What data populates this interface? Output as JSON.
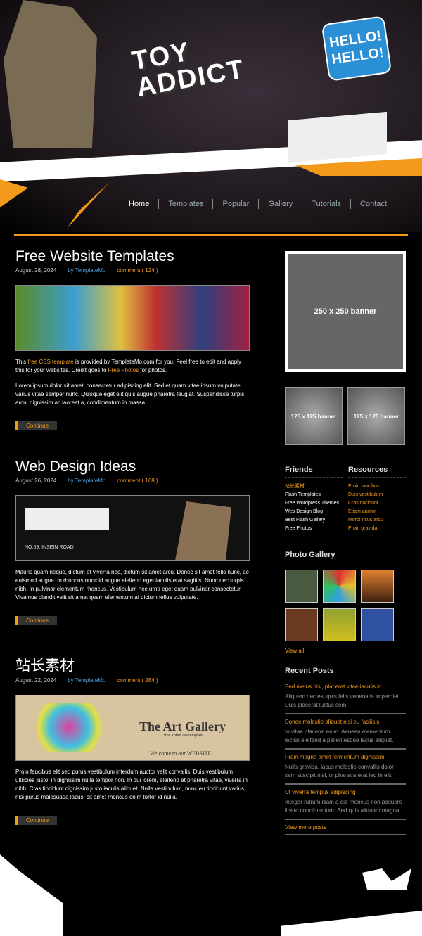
{
  "header": {
    "logo_text": "TOY ADDICT",
    "bubble_text": "HELLO! HELLO!"
  },
  "nav": [
    {
      "label": "Home"
    },
    {
      "label": "Templates"
    },
    {
      "label": "Popular"
    },
    {
      "label": "Gallery"
    },
    {
      "label": "Tutorials"
    },
    {
      "label": "Contact"
    }
  ],
  "posts": [
    {
      "title": "Free Website Templates",
      "date": "August 28, 2024",
      "author": "by TemplateMo",
      "comments": "comment ( 124 )",
      "intro_pre": "This ",
      "intro_link1": "free CSS template",
      "intro_mid": " is provided by TemplateMo.com for you. Feel free to edit and apply this for your websites. Credit goes to ",
      "intro_link2": "Free Photos",
      "intro_post": " for photos.",
      "body": "Lorem ipsum dolor sit amet, consectetur adipiscing elit. Sed et quam vitae ipsum vulputate varius vitae semper nunc. Quisque eget elit quis augue pharetra feugiat. Suspendisse turpis arcu, dignissim ac laoreet a, condimentum in massa.",
      "continue": "Continue"
    },
    {
      "title": "Web Design Ideas",
      "date": "August 26, 2024",
      "author": "by TemplateMo",
      "comments": "comment ( 168 )",
      "image_text": "NO.69, INSEIN ROAD",
      "body": "Mauris quam neque, dictum et viverra nec, dictum sit amet arcu. Donec sit amet felis nunc, ac euismod augue. In rhoncus nunc id augue eleifend eget iaculis erat sagittis. Nunc nec turpis nibh. In pulvinar elementum rhoncus. Vestibulum nec urna eget quam pulvinar consectetur. Vivamus blandit velit sit amet quam elementum at dictum tellus vulputate.",
      "continue": "Continue"
    },
    {
      "title": "站长素材",
      "date": "August 22, 2024",
      "author": "by TemplateMo",
      "comments": "comment ( 284 )",
      "image_title": "The Art Gallery",
      "image_sub": "free xhtml css template",
      "image_welcome": "Welcome to our WEBSITE",
      "body": "Proin faucibus elit sed purus vestibulum interdum auctor velit convallis. Duis vestibulum ultricies justo, in dignissim nulla tempor non. In dui lorem, eleifend et pharetra vitae, viverra in nibh. Cras tincidunt dignissim justo iaculis aliquet. Nulla vestibulum, nunc eu tincidunt varius, nisi purus malesuada lacus, sit amet rhoncus enim tortor id nulla.",
      "continue": "Continue"
    }
  ],
  "sidebar": {
    "banner_large": "250 x 250 banner",
    "banner_small": "125 x 125 banner",
    "friends": {
      "title": "Friends",
      "items": [
        "站长素材",
        "Flash Templates",
        "Free Wordpress Themes",
        "Web Design Blog",
        "Best Flash Gallery",
        "Free Photos"
      ]
    },
    "resources": {
      "title": "Resources",
      "items": [
        "Proin faucibus",
        "Duis vestibulum",
        "Cras tincidunt",
        "Etiam auctor",
        "Morbi risus arcu",
        "Proin gravida"
      ]
    },
    "gallery": {
      "title": "Photo Gallery",
      "view_all": "View all"
    },
    "recent": {
      "title": "Recent Posts",
      "items": [
        {
          "title": "Sed metus nisl, placerat vitae iaculis in",
          "desc": "Aliquam nec est quis felis venenatis imperdiet. Duis placerat luctus sem."
        },
        {
          "title": "Donec molestie aliquet nisi eu facilisis",
          "desc": "In vitae placerat enim. Aenean elementum lectus eleifend a pellentesque lacus aliquet."
        },
        {
          "title": "Proin magna amet fermentum dignissim",
          "desc": "Nulla gravida, lacus molestie convallis dolor sem suscipit nisl, ut pharetra erat leo in elit."
        },
        {
          "title": "Ut viverra tempus adipiscing",
          "desc": "Integer rutrum diam a est rhoncus non posuere libero condimentum. Sed quis aliquam magna."
        }
      ],
      "more": "View more posts"
    }
  },
  "colors": {
    "accent": "#f39a1d",
    "link_blue": "#4fa3e0",
    "background": "#000000"
  }
}
